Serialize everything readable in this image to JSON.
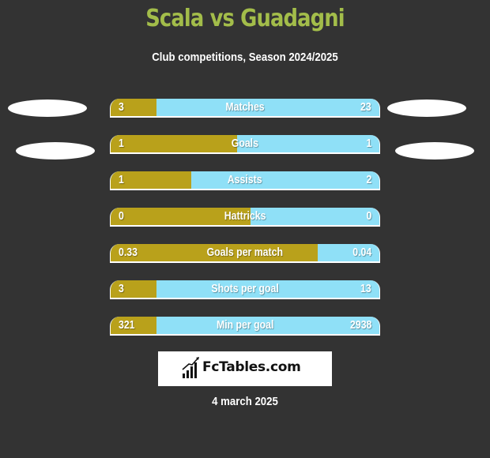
{
  "header": {
    "title": "Scala vs Guadagni",
    "subtitle": "Club competitions, Season 2024/2025"
  },
  "colors": {
    "left_player": "#b9a11b",
    "right_player": "#8fe0f7",
    "title": "#a3bd4a",
    "background": "#333333"
  },
  "stats": [
    {
      "label": "Matches",
      "left": "3",
      "right": "23",
      "left_share": 0.17
    },
    {
      "label": "Goals",
      "left": "1",
      "right": "1",
      "left_share": 0.47
    },
    {
      "label": "Assists",
      "left": "1",
      "right": "2",
      "left_share": 0.3
    },
    {
      "label": "Hattricks",
      "left": "0",
      "right": "0",
      "left_share": 0.52
    },
    {
      "label": "Goals per match",
      "left": "0.33",
      "right": "0.04",
      "left_share": 0.77
    },
    {
      "label": "Shots per goal",
      "left": "3",
      "right": "13",
      "left_share": 0.17
    },
    {
      "label": "Min per goal",
      "left": "321",
      "right": "2938",
      "left_share": 0.17
    }
  ],
  "logo": {
    "text": "FcTables.com",
    "icon": "bar-chart-trend-icon"
  },
  "footer": {
    "date": "4 march 2025"
  }
}
